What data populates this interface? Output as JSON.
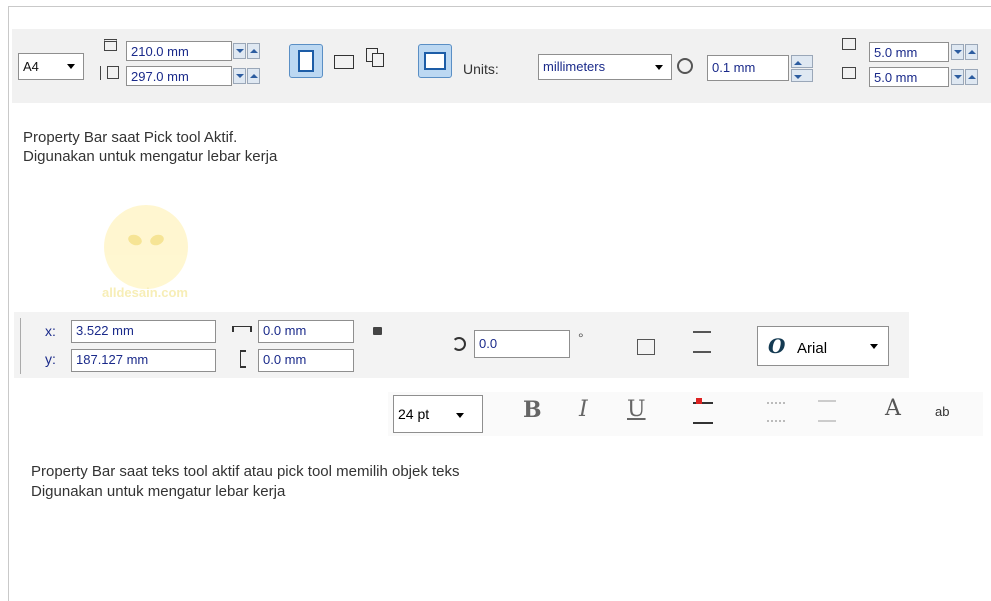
{
  "pick_bar": {
    "paper_size": "A4",
    "width": "210.0 mm",
    "height": "297.0 mm",
    "units_label": "Units:",
    "units_value": "millimeters",
    "nudge": "0.1 mm",
    "dup_x": "5.0 mm",
    "dup_y": "5.0 mm"
  },
  "caption1": {
    "line1": "Property Bar saat Pick tool Aktif.",
    "line2": "Digunakan untuk mengatur lebar kerja"
  },
  "watermark_text": "alldesain.com",
  "text_bar": {
    "x_label": "x:",
    "x_value": "3.522 mm",
    "y_label": "y:",
    "y_value": "187.127 mm",
    "w_value": "0.0 mm",
    "h_value": "0.0 mm",
    "rotation": "0.0",
    "degree": "°",
    "font_name": "Arial",
    "font_size": "24 pt"
  },
  "caption2": {
    "line1": "Property Bar saat teks tool aktif atau pick tool memilih objek teks",
    "line2": "Digunakan untuk mengatur lebar kerja"
  },
  "icons": {
    "bold": "B",
    "italic": "I",
    "underline": "U",
    "font_glyph": "O",
    "text_effect": "A",
    "edit_text": "ab"
  }
}
